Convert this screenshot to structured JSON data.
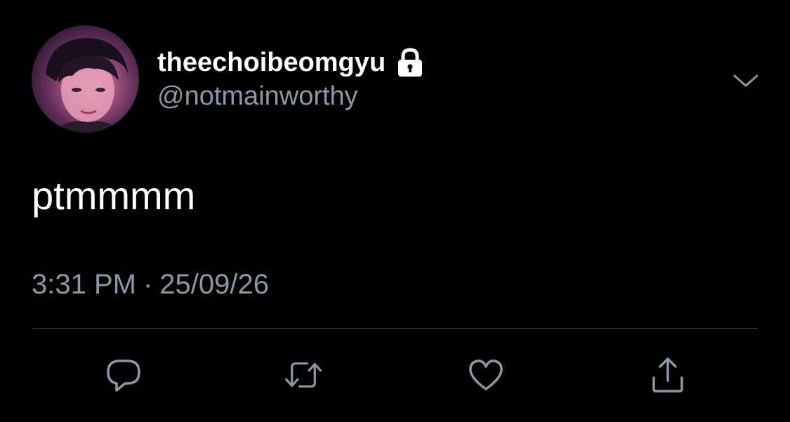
{
  "tweet": {
    "display_name": "theechoibeomgyu",
    "handle": "@notmainworthy",
    "protected": true,
    "text": "ptmmmm",
    "time": "3:31 PM",
    "separator": "·",
    "date": "25/09/26"
  },
  "icons": {
    "avatar": "profile-photo",
    "lock": "lock-icon",
    "caret": "chevron-down-icon",
    "reply": "reply-icon",
    "retweet": "retweet-icon",
    "like": "heart-icon",
    "share": "share-icon"
  },
  "colors": {
    "background": "#000000",
    "primary_text": "#ffffff",
    "secondary_text": "#8b98a5",
    "divider": "#38444d"
  }
}
